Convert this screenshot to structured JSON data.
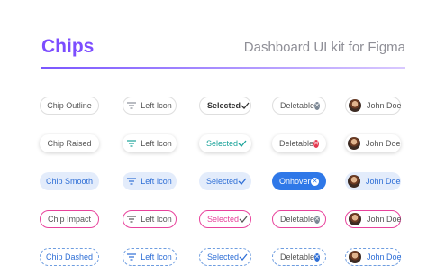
{
  "header": {
    "title": "Chips",
    "subtitle": "Dashboard UI kit for Figma"
  },
  "colors": {
    "title": "#7c4dff",
    "divider_start": "#7a56ff",
    "smooth_bg": "#e3ecfb",
    "blue": "#2f6fd6",
    "impact_pink": "#e8439c",
    "raised_teal": "#1aa39a",
    "onhover_bg": "#2f78e8",
    "delete_red": "#e53950"
  },
  "rows": [
    {
      "variant": "outline",
      "chip": "Chip Outline",
      "left_icon": "Left Icon",
      "selected": "Selected",
      "deletable": "Deletable",
      "avatar_name": "John Doe"
    },
    {
      "variant": "raised",
      "chip": "Chip Raised",
      "left_icon": "Left Icon",
      "selected": "Selected",
      "deletable": "Deletable",
      "avatar_name": "John Doe"
    },
    {
      "variant": "smooth",
      "chip": "Chip Smooth",
      "left_icon": "Left Icon",
      "selected": "Selected",
      "deletable": "Onhover",
      "avatar_name": "John Doe"
    },
    {
      "variant": "impact",
      "chip": "Chip Impact",
      "left_icon": "Left Icon",
      "selected": "Selected",
      "deletable": "Deletable",
      "avatar_name": "John Doe"
    },
    {
      "variant": "dashed",
      "chip": "Chip Dashed",
      "left_icon": "Left Icon",
      "selected": "Selected",
      "deletable": "Deletable",
      "avatar_name": "John Doe"
    }
  ],
  "icons": {
    "left_icon": "filter-lines-icon",
    "selected": "check-icon",
    "delete": "close-circle-icon",
    "avatar": "user-avatar"
  }
}
